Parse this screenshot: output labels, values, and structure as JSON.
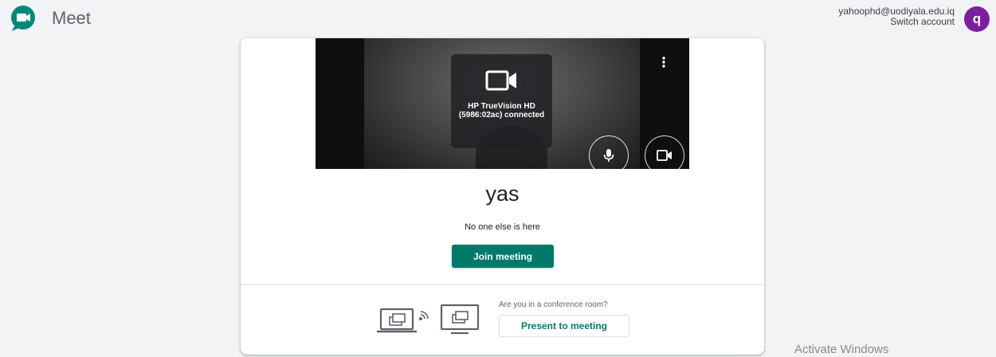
{
  "app": {
    "name": "Meet"
  },
  "account": {
    "email": "yahoophd@uodiyala.edu.iq",
    "switch_label": "Switch account",
    "avatar_letter": "q"
  },
  "preview": {
    "device_name": "HP TrueVision HD (5986:02ac) connected"
  },
  "meeting": {
    "title": "yas",
    "status": "No one else is here",
    "join_label": "Join meeting"
  },
  "conference": {
    "question": "Are you in a conference room?",
    "present_label": "Present to meeting"
  },
  "watermark": {
    "text": "Activate Windows"
  },
  "colors": {
    "accent": "#00796b",
    "avatar": "#7b1fa2"
  }
}
